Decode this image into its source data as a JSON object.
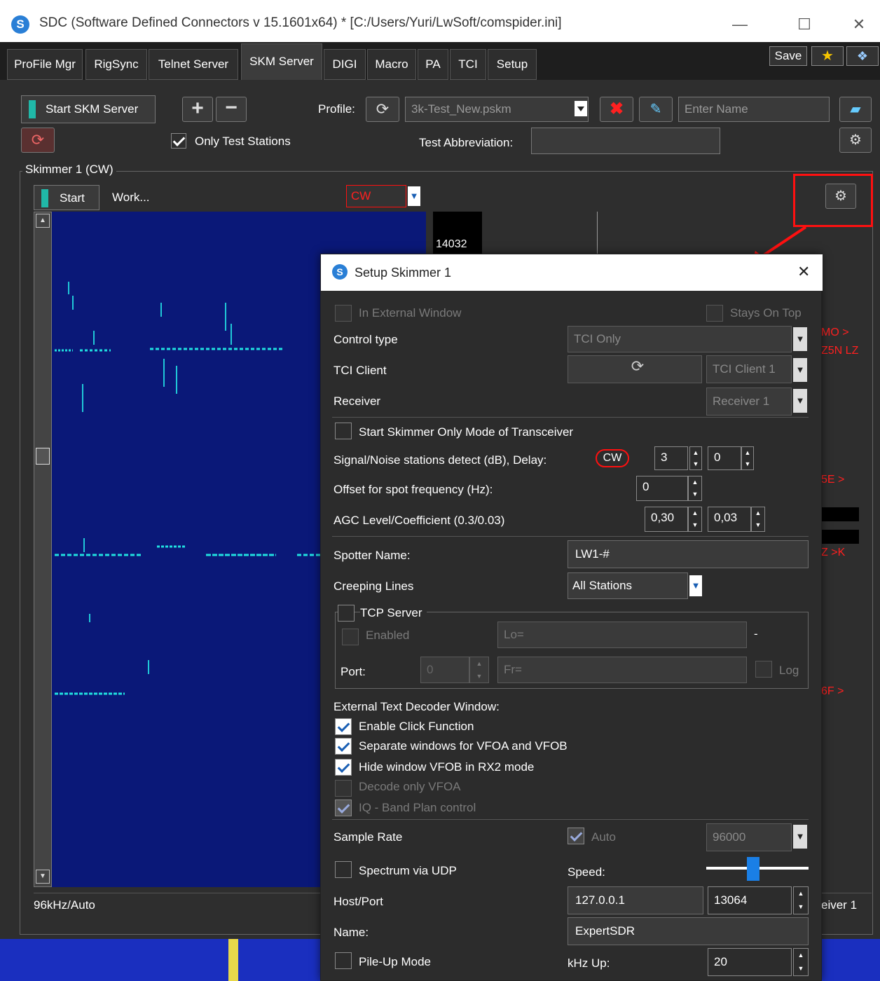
{
  "window": {
    "title": "SDC (Software Defined Connectors v 15.1601x64) * [C:/Users/Yuri/LwSoft/comspider.ini]",
    "logo_letter": "S",
    "minimize_glyph": "—",
    "maximize_glyph": "☐",
    "close_glyph": "✕"
  },
  "tabs": [
    "ProFile Mgr",
    "RigSync",
    "Telnet Server",
    "SKM Server",
    "DIGI",
    "Macro",
    "PA",
    "TCI",
    "Setup"
  ],
  "top_buttons": {
    "save": "Save",
    "star_icon": "star-icon",
    "bird_icon": "bird-icon"
  },
  "toolbar": {
    "start_server": "Start SKM Server",
    "profile_label": "Profile:",
    "profile_value": "3k-Test_New.pskm",
    "name_placeholder": "Enter Name",
    "only_test_stations": "Only Test Stations",
    "test_abbrev_label": "Test Abbreviation:",
    "test_abbrev_value": ""
  },
  "skimmer": {
    "group_title": "Skimmer 1 (CW)",
    "start": "Start",
    "work": "Work...",
    "mode": "CW",
    "freq_marker": "14032",
    "status_left": "96kHz/Auto",
    "status_right": "eiver 1",
    "right_calls": [
      "MO >",
      "Z5N LZ",
      "5E >",
      "Z >K",
      "6F >"
    ]
  },
  "dialog": {
    "title": "Setup Skimmer 1",
    "in_external_window": "In External Window",
    "stays_on_top": "Stays On Top",
    "control_type_label": "Control type",
    "control_type_value": "TCI Only",
    "tci_client_label": "TCI Client",
    "tci_client_value": "TCI Client 1",
    "receiver_label": "Receiver",
    "receiver_value": "Receiver 1",
    "start_skimmer_only": "Start Skimmer Only Mode of Transceiver",
    "snr_label": "Signal/Noise stations detect (dB), Delay:",
    "snr_mode": "CW",
    "snr_value": "3",
    "delay_value": "0",
    "offset_label": "Offset for spot frequency (Hz):",
    "offset_value": "0",
    "agc_label": "AGC Level/Coefficient (0.3/0.03)",
    "agc_level": "0,30",
    "agc_coef": "0,03",
    "spotter_label": "Spotter Name:",
    "spotter_value": "LW1-#",
    "creeping_label": "Creeping Lines",
    "creeping_value": "All Stations",
    "tcp_server": "TCP Server",
    "enabled": "Enabled",
    "lo_placeholder": "Lo=",
    "dash": "-",
    "port_label": "Port:",
    "port_value": "0",
    "fr_placeholder": "Fr=",
    "log": "Log",
    "ext_decoder_label": "External Text Decoder Window:",
    "enable_click": "Enable Click Function",
    "separate_windows": "Separate windows for VFOA and VFOB",
    "hide_vfob": "Hide window VFOB in RX2 mode",
    "decode_only_vfoa": "Decode only VFOA",
    "iq_band_plan": "IQ - Band Plan control",
    "sample_rate_label": "Sample Rate",
    "sample_auto": "Auto",
    "sample_value": "96000",
    "spectrum_udp": "Spectrum via UDP",
    "speed_label": "Speed:",
    "speed_level": 0.45,
    "host_port_label": "Host/Port",
    "host_value": "127.0.0.1",
    "port2_value": "13064",
    "name_label": "Name:",
    "name_value": "ExpertSDR",
    "pileup": "Pile-Up Mode",
    "khz_up_label": "kHz Up:",
    "khz_up_value": "20"
  },
  "colors": {
    "accent_red": "#ff1010",
    "waterfall": "#0a1878",
    "trace": "#20e0e0",
    "teal": "#20b8a8"
  }
}
